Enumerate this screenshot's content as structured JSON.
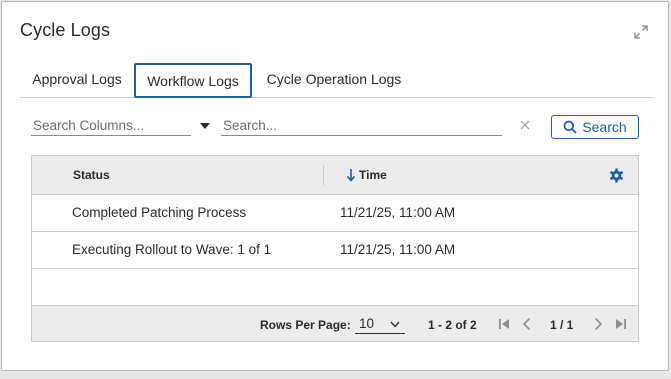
{
  "panel": {
    "title": "Cycle Logs",
    "expand_icon": "expand-icon"
  },
  "tabs": [
    {
      "label": "Approval Logs",
      "active": false
    },
    {
      "label": "Workflow Logs",
      "active": true
    },
    {
      "label": "Cycle Operation Logs",
      "active": false
    }
  ],
  "filters": {
    "column_placeholder": "Search Columns...",
    "search_placeholder": "Search...",
    "search_button": "Search"
  },
  "table": {
    "columns": [
      "Status",
      "Time"
    ],
    "sorted_column": "Time",
    "sort_direction": "descending",
    "rows": [
      {
        "status": "Completed Patching Process",
        "time": "11/21/25, 11:00 AM"
      },
      {
        "status": "Executing Rollout to Wave: 1 of 1",
        "time": "11/21/25, 11:00 AM"
      }
    ]
  },
  "pagination": {
    "rows_per_page_label": "Rows Per Page:",
    "rows_per_page": "10",
    "range": "1 - 2 of 2",
    "page": "1 / 1"
  },
  "colors": {
    "accent": "#1f5f9e",
    "header_bg": "#ececec",
    "border": "#c9c9c9"
  }
}
